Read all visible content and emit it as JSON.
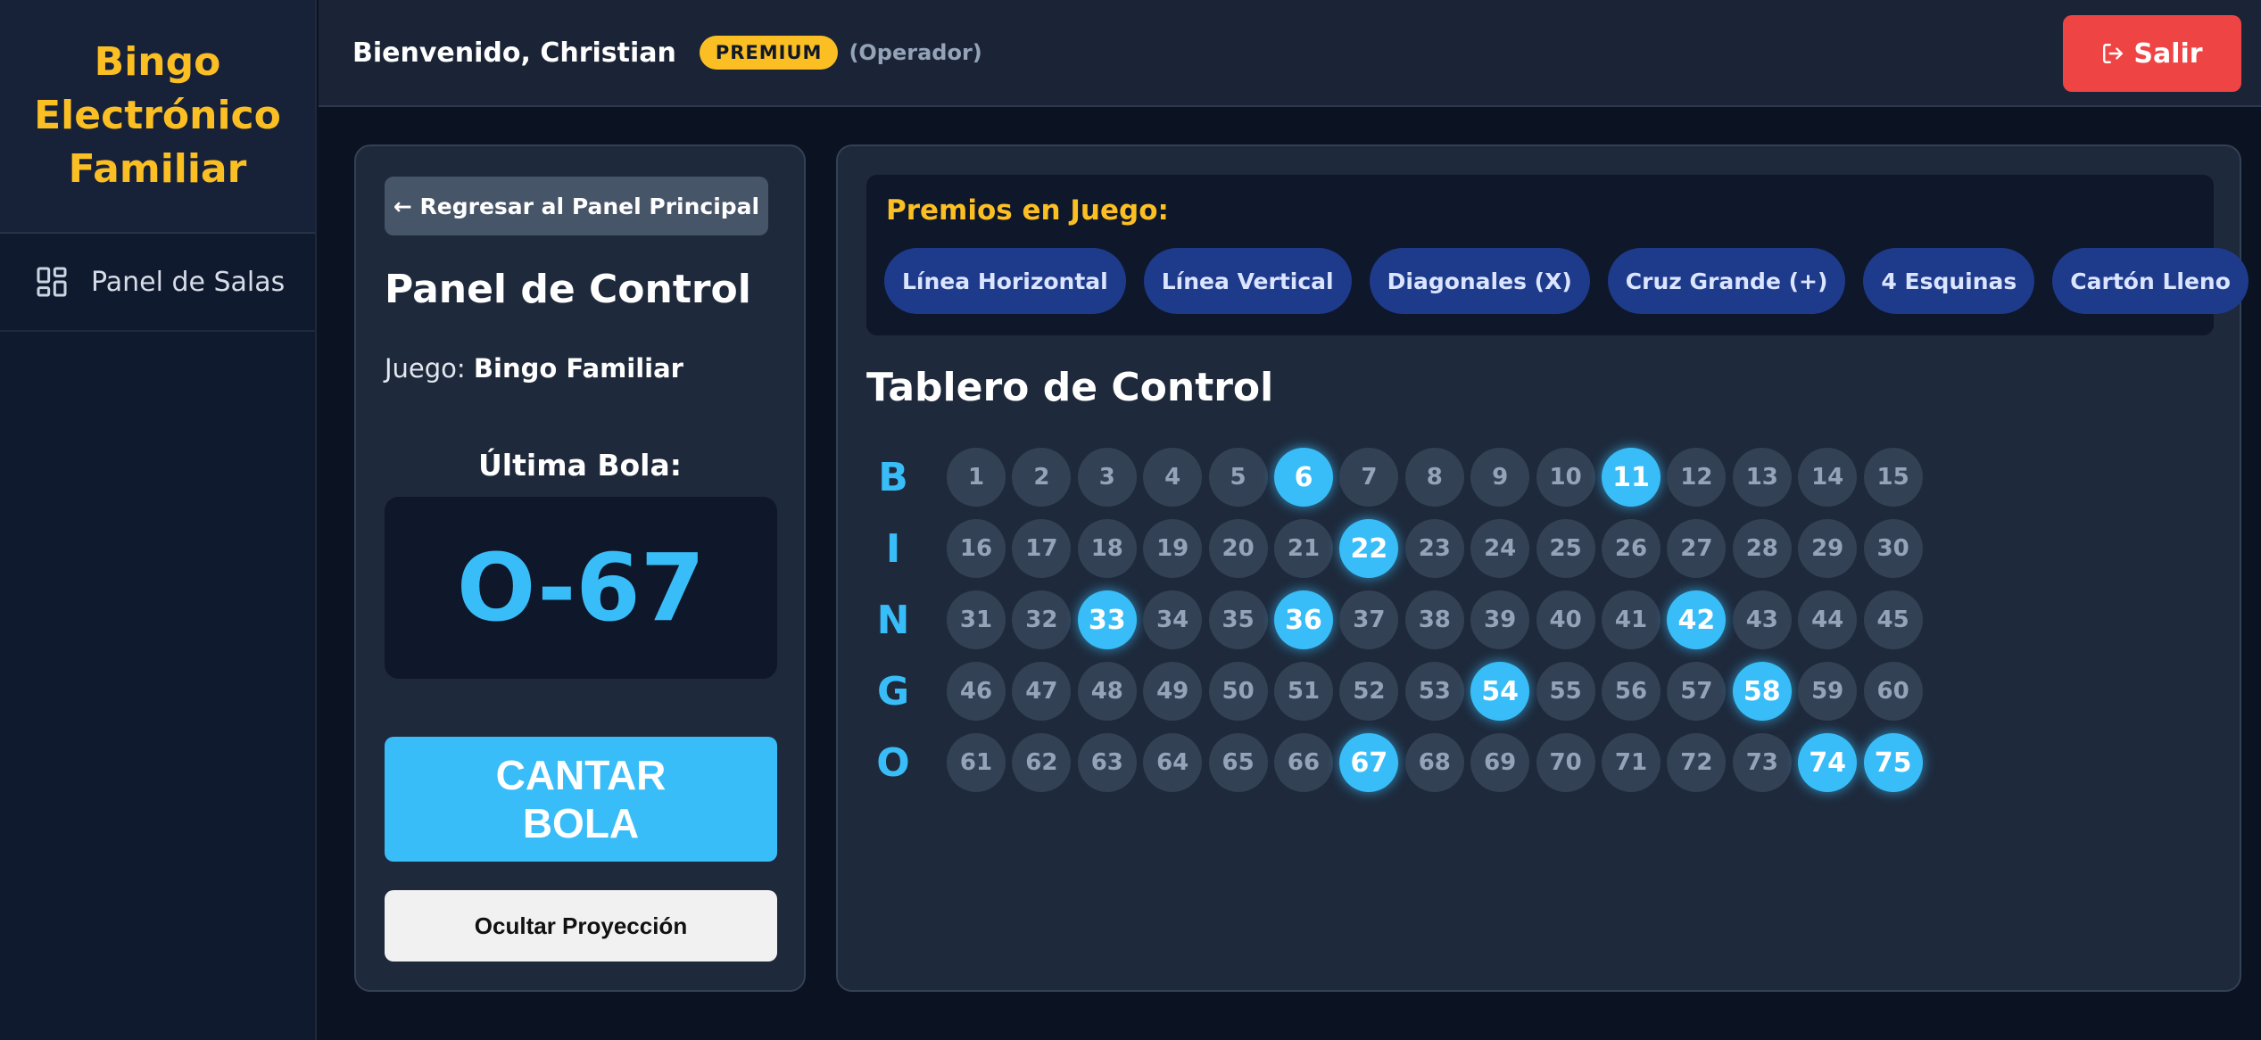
{
  "brand": {
    "title": "Bingo Electrónico Familiar",
    "color": "#fbbf24"
  },
  "sidebar": {
    "items": [
      {
        "label": "Panel de Salas",
        "icon": "dashboard-icon"
      }
    ]
  },
  "header": {
    "welcome": "Bienvenido, Christian",
    "badge": "PREMIUM",
    "role": "(Operador)",
    "logout_label": "Salir",
    "logout_icon": "logout-icon"
  },
  "control": {
    "back_label": "← Regresar al Panel Principal",
    "title": "Panel de Control",
    "game_prefix": "Juego: ",
    "game_name": "Bingo Familiar",
    "last_ball_label": "Última Bola:",
    "last_ball": "O-67",
    "call_label": "CANTAR BOLA",
    "hide_label": "Ocultar Proyección"
  },
  "prizes": {
    "title": "Premios en Juego:",
    "items": [
      "Línea Horizontal",
      "Línea Vertical",
      "Diagonales (X)",
      "Cruz Grande (+)",
      "4 Esquinas",
      "Cartón Lleno"
    ]
  },
  "board": {
    "title": "Tablero de Control",
    "letters": [
      "B",
      "I",
      "N",
      "G",
      "O"
    ],
    "called": [
      6,
      11,
      22,
      33,
      36,
      42,
      54,
      58,
      67,
      74,
      75
    ],
    "accent": "#38bdf8"
  }
}
